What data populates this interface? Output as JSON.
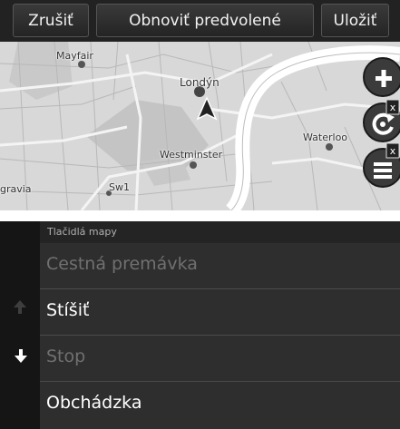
{
  "toolbar": {
    "cancel_label": "Zrušiť",
    "restore_label": "Obnoviť predvolené",
    "save_label": "Uložiť"
  },
  "map": {
    "labels": [
      "Mayfair",
      "Londýn",
      "Westminster",
      "Waterloo",
      "Sw1",
      "gravia"
    ]
  },
  "side_buttons": {
    "icons": [
      "zoom-in-icon",
      "rotate-icon",
      "map-layers-icon"
    ],
    "remove_badge": "x"
  },
  "menu": {
    "header": "Tlačidlá mapy",
    "items": [
      {
        "label": "Cestná premávka",
        "enabled": false
      },
      {
        "label": "Stíšiť",
        "enabled": true
      },
      {
        "label": "Stop",
        "enabled": false
      },
      {
        "label": "Obchádzka",
        "enabled": true
      }
    ]
  },
  "colors": {
    "toolbar": "#121212",
    "menu_bg": "#2e2e2e",
    "map_bg": "#d9d9d9",
    "river": "#ffffff"
  }
}
